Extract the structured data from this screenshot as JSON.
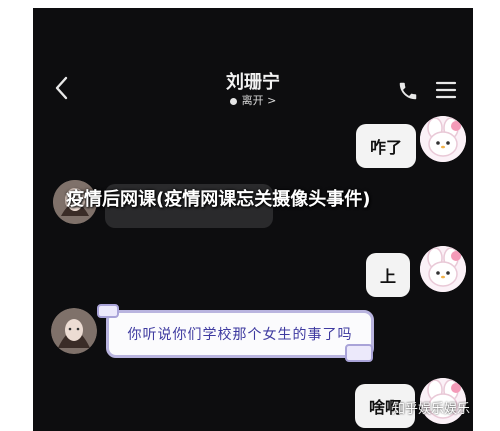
{
  "header": {
    "title": "刘珊宁",
    "status": "离开 >",
    "back_icon": "chevron-left-icon",
    "call_icon": "phone-icon",
    "menu_icon": "hamburger-menu-icon"
  },
  "messages": {
    "msg1": "咋了",
    "msg2": "上",
    "msg3": "你听说你们学校那个女生的事了吗",
    "msg4": "啥啊"
  },
  "overlay": {
    "title": "疫情后网课(疫情网课忘关摄像头事件)"
  },
  "watermark": "知乎娱乐娱乐",
  "colors": {
    "background": "#0d0d0f",
    "bubble_right": "#f3f3f3",
    "sticker_border": "#b9b4df",
    "sticker_text": "#3e3aa0"
  }
}
